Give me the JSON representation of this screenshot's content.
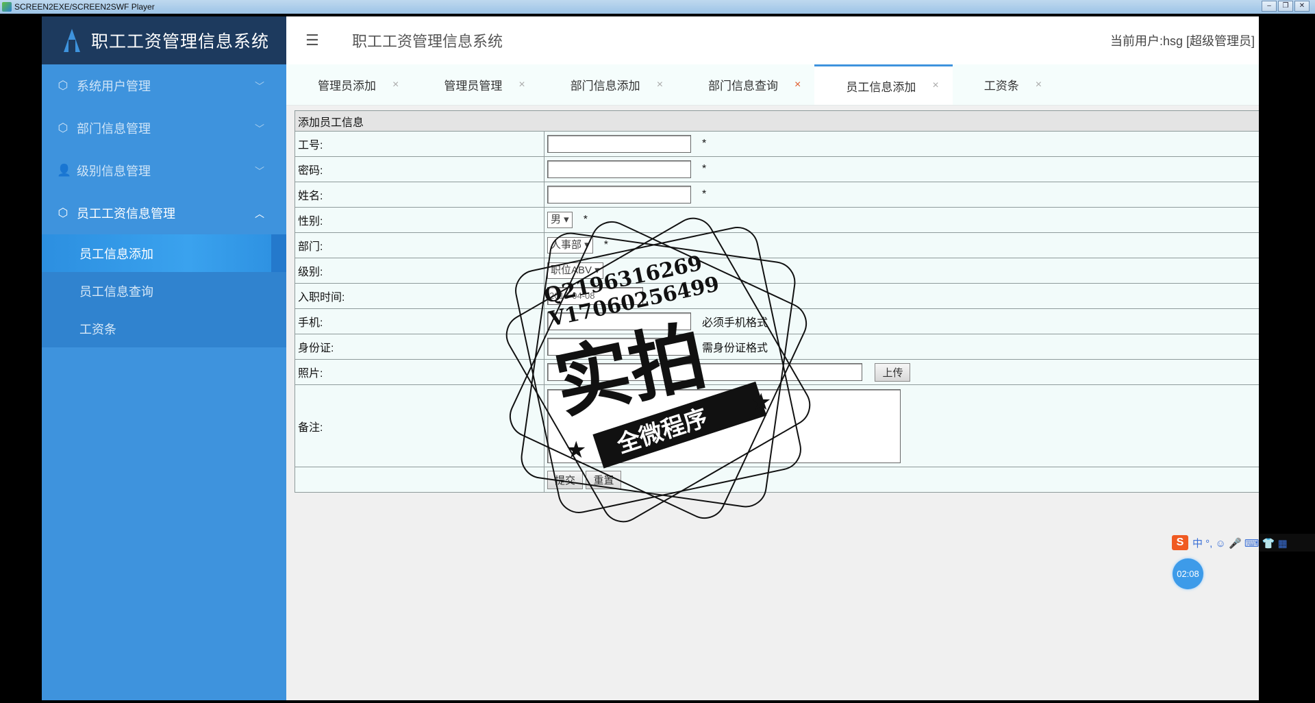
{
  "window": {
    "title": "SCREEN2EXE/SCREEN2SWF Player"
  },
  "brand": {
    "title": "职工工资管理信息系统"
  },
  "sidebar": {
    "groups": [
      {
        "label": "系统用户管理",
        "icon": "cube-icon"
      },
      {
        "label": "部门信息管理",
        "icon": "cube-icon"
      },
      {
        "label": "级别信息管理",
        "icon": "user-icon"
      },
      {
        "label": "员工工资信息管理",
        "icon": "cube-icon"
      }
    ],
    "sub_items": [
      {
        "label": "员工信息添加"
      },
      {
        "label": "员工信息查询"
      },
      {
        "label": "工资条"
      }
    ]
  },
  "topbar": {
    "title": "职工工资管理信息系统",
    "user": "当前用户:hsg [超级管理员]"
  },
  "tabs": [
    {
      "label": "管理员添加",
      "close": "×"
    },
    {
      "label": "管理员管理",
      "close": "×"
    },
    {
      "label": "部门信息添加",
      "close": "×"
    },
    {
      "label": "部门信息查询",
      "close": "×"
    },
    {
      "label": "员工信息添加",
      "close": "×"
    },
    {
      "label": "工资条",
      "close": "×"
    }
  ],
  "form": {
    "header": "添加员工信息",
    "fields": {
      "id_label": "工号:",
      "pwd_label": "密码:",
      "name_label": "姓名:",
      "gender_label": "性别:",
      "gender_value": "男",
      "dept_label": "部门:",
      "dept_value": "人事部",
      "level_label": "级别:",
      "level_value": "职位ABV",
      "join_label": "入职时间:",
      "join_value": "2018-04-08",
      "phone_label": "手机:",
      "phone_hint": "必须手机格式",
      "idcard_label": "身份证:",
      "idcard_hint": "需身份证格式",
      "photo_label": "照片:",
      "upload_label": "上传",
      "remark_label": "备注:",
      "required": "*"
    },
    "submit_label": "提交",
    "reset_label": "重置"
  },
  "watermark": {
    "line1": "Q2196316269",
    "line2": "V17060256499",
    "big": "实拍",
    "banner": "全微程序"
  },
  "ime": {
    "logo": "S",
    "text": "中 °, ☺ 🎤 ⌨ 👕 ▦"
  },
  "timer": {
    "text": "02:08"
  }
}
